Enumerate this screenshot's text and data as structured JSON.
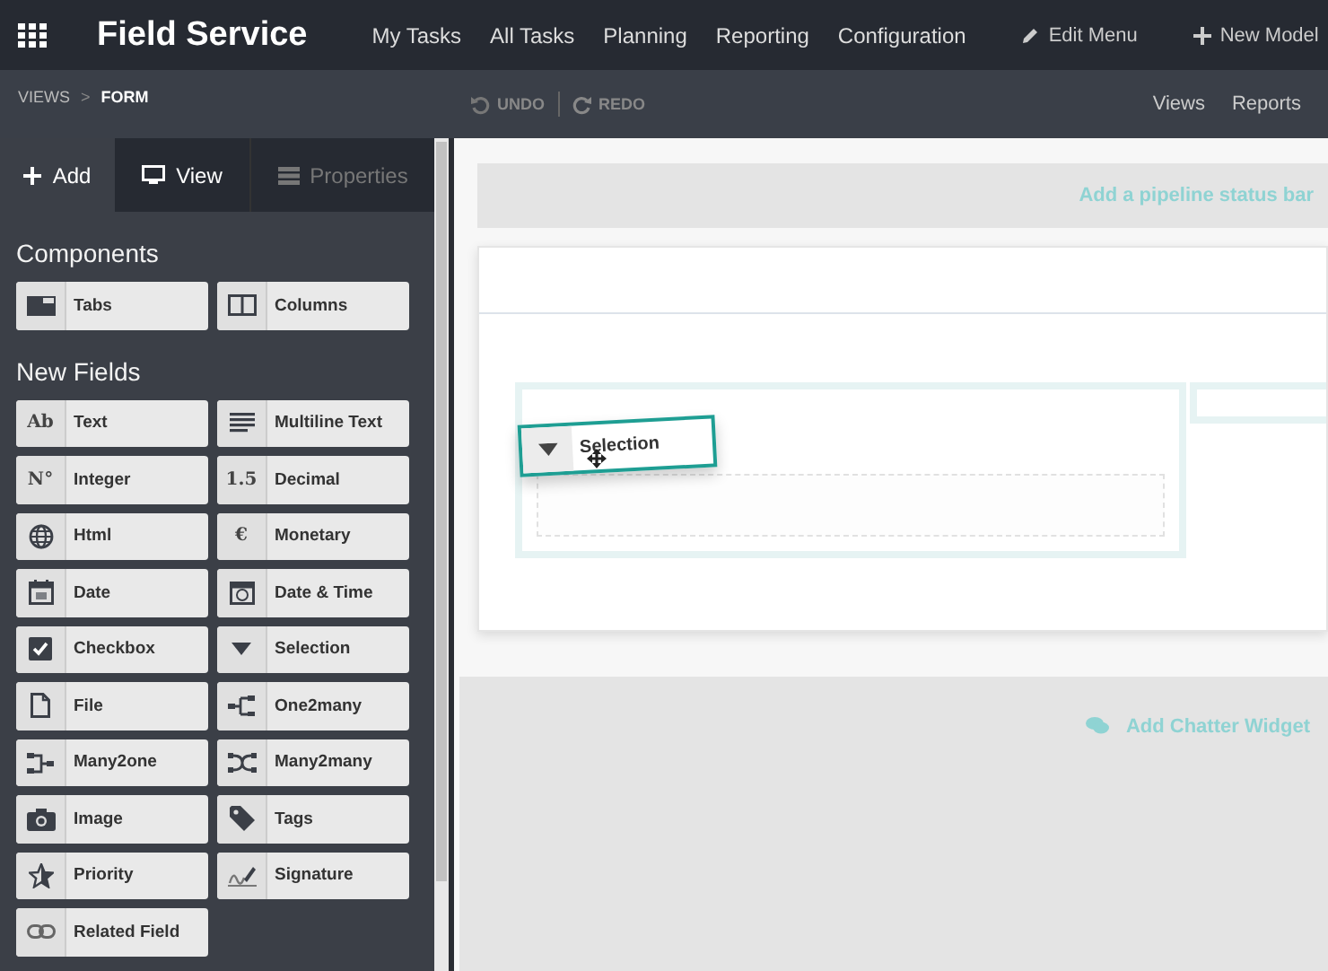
{
  "app": {
    "title": "Field Service"
  },
  "menu": [
    {
      "label": "My Tasks"
    },
    {
      "label": "All Tasks"
    },
    {
      "label": "Planning"
    },
    {
      "label": "Reporting"
    },
    {
      "label": "Configuration"
    }
  ],
  "actions": [
    {
      "kind": "edit",
      "label": "Edit Menu"
    },
    {
      "kind": "add",
      "label": "New Model"
    }
  ],
  "breadcrumb": [
    {
      "label": "VIEWS",
      "selected": false
    },
    {
      "label": "FORM",
      "selected": true
    }
  ],
  "breadcrumb_separator": ">",
  "history": [
    {
      "kind": "undo",
      "label": "UNDO"
    },
    {
      "kind": "redo",
      "label": "REDO"
    }
  ],
  "right_links": [
    {
      "label": "Views"
    },
    {
      "label": "Reports"
    }
  ],
  "tabs": [
    {
      "kind": "add",
      "label": "Add",
      "selected": true,
      "disabled": false
    },
    {
      "kind": "view",
      "label": "View",
      "selected": false,
      "disabled": false
    },
    {
      "kind": "properties",
      "label": "Properties",
      "selected": false,
      "disabled": true
    }
  ],
  "sections": [
    {
      "title": "Components",
      "items": [
        {
          "label": "Tabs"
        },
        {
          "label": "Columns"
        }
      ]
    },
    {
      "title": "New Fields",
      "items": [
        {
          "label": "Text",
          "glyph": "Ab"
        },
        {
          "label": "Multiline Text"
        },
        {
          "label": "Integer",
          "glyph": "N°"
        },
        {
          "label": "Decimal",
          "glyph": "1.5"
        },
        {
          "label": "Html"
        },
        {
          "label": "Monetary",
          "glyph": "€"
        },
        {
          "label": "Date"
        },
        {
          "label": "Date & Time"
        },
        {
          "label": "Checkbox"
        },
        {
          "label": "Selection"
        },
        {
          "label": "File"
        },
        {
          "label": "One2many"
        },
        {
          "label": "Many2one"
        },
        {
          "label": "Many2many"
        },
        {
          "label": "Image"
        },
        {
          "label": "Tags"
        },
        {
          "label": "Priority"
        },
        {
          "label": "Signature"
        },
        {
          "label": "Related Field"
        }
      ]
    }
  ],
  "canvas": {
    "status_bar_hint": "Add a pipeline status bar",
    "chatter_hint": "Add Chatter Widget"
  },
  "dragged": {
    "label": "Selection"
  }
}
